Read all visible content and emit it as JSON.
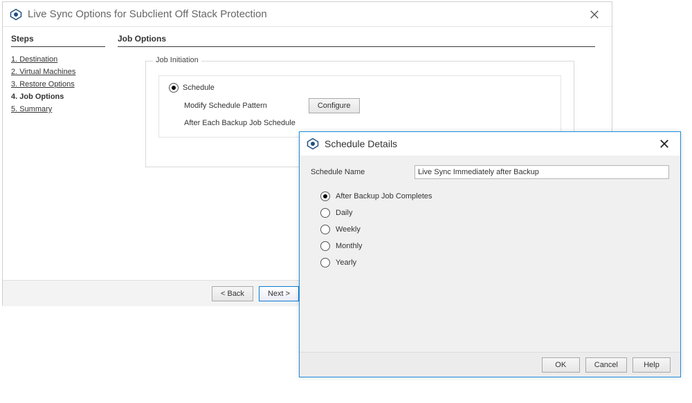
{
  "main": {
    "title": "Live Sync Options for Subclient Off Stack Protection",
    "steps_heading": "Steps",
    "steps": [
      "1. Destination",
      "2. Virtual Machines",
      "3. Restore Options",
      "4. Job Options",
      "5. Summary"
    ],
    "current_step_index": 3,
    "content_heading": "Job Options",
    "job_initiation_legend": "Job Initiation",
    "schedule_radio_label": "Schedule",
    "modify_pattern_label": "Modify Schedule Pattern",
    "configure_button": "Configure",
    "after_backup_label": "After Each Backup Job Schedule",
    "back_button": "< Back",
    "next_button": "Next >"
  },
  "modal": {
    "title": "Schedule Details",
    "name_label": "Schedule Name",
    "name_value": "Live Sync Immediately after Backup",
    "options": [
      "After Backup Job Completes",
      "Daily",
      "Weekly",
      "Monthly",
      "Yearly"
    ],
    "selected_option_index": 0,
    "ok_button": "OK",
    "cancel_button": "Cancel",
    "help_button": "Help"
  }
}
